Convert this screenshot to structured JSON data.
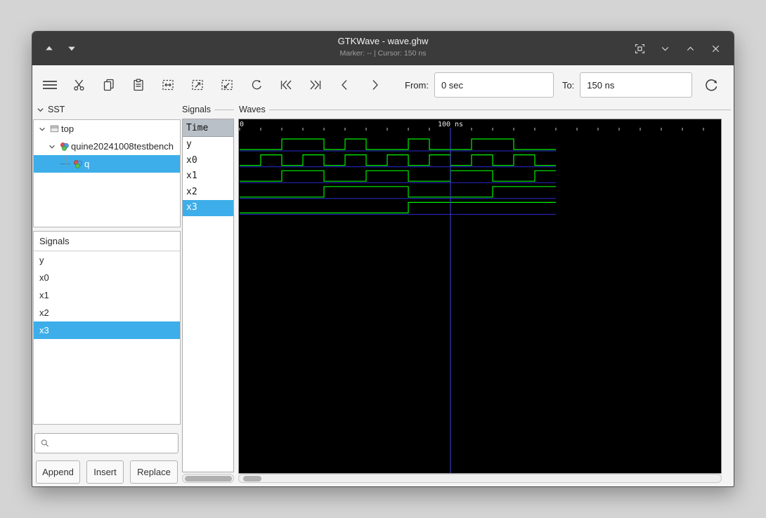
{
  "window": {
    "title": "GTKWave - wave.ghw",
    "statusline": "Marker: --  |  Cursor: 150 ns"
  },
  "colors": {
    "accent": "#3daee9",
    "titlebar": "#3b3b3b"
  },
  "toolbar": {
    "icons": [
      "menu",
      "cut",
      "copy",
      "paste",
      "zoom-fit",
      "zoom-in",
      "zoom-out",
      "undo",
      "goto-start",
      "goto-end",
      "prev-edge",
      "next-edge",
      "reload"
    ],
    "from_label": "From:",
    "from_value": "0 sec",
    "to_label": "To:",
    "to_value": "150 ns"
  },
  "sst": {
    "label": "SST",
    "tree": [
      {
        "label": "top",
        "icon": "chip-icon",
        "expanded": true,
        "selected": false
      },
      {
        "label": "quine20241008testbench",
        "icon": "module-icon",
        "expanded": true,
        "selected": false
      },
      {
        "label": "q",
        "icon": "module-icon",
        "selected": true
      }
    ]
  },
  "signals_list": {
    "header": "Signals",
    "items": [
      "y",
      "x0",
      "x1",
      "x2",
      "x3"
    ],
    "selected_index": 4
  },
  "actions": {
    "append": "Append",
    "insert": "Insert",
    "replace": "Replace"
  },
  "wave_names": {
    "header": "Signals",
    "time_header": "Time",
    "items": [
      "y",
      "x0",
      "x1",
      "x2",
      "x3"
    ],
    "selected_index": 4
  },
  "waves": {
    "header": "Waves",
    "timeline_labels": [
      {
        "ns": 0,
        "text": "0"
      },
      {
        "ns": 100,
        "text": "100 ns"
      }
    ],
    "cursor_ns": 100,
    "ns_per_slot": 10,
    "total_ns": 150,
    "signals": [
      {
        "name": "y",
        "bits": [
          0,
          0,
          1,
          1,
          0,
          1,
          0,
          0,
          1,
          0,
          0,
          1,
          1,
          0,
          0
        ]
      },
      {
        "name": "x0",
        "bits": [
          0,
          1,
          0,
          1,
          0,
          1,
          0,
          1,
          0,
          1,
          0,
          1,
          0,
          1,
          0
        ]
      },
      {
        "name": "x1",
        "bits": [
          0,
          0,
          1,
          1,
          0,
          0,
          1,
          1,
          0,
          0,
          1,
          1,
          0,
          0,
          1
        ]
      },
      {
        "name": "x2",
        "bits": [
          0,
          0,
          0,
          0,
          1,
          1,
          1,
          1,
          0,
          0,
          0,
          0,
          1,
          1,
          1
        ]
      },
      {
        "name": "x3",
        "bits": [
          0,
          0,
          0,
          0,
          0,
          0,
          0,
          0,
          1,
          1,
          1,
          1,
          1,
          1,
          1
        ]
      }
    ],
    "colors": {
      "trace": "#00f000",
      "baseline": "#2a2ad0",
      "cursor": "#4048d8",
      "bg": "#000000",
      "tick": "#c8c8c8",
      "label": "#e8e8e8"
    }
  }
}
